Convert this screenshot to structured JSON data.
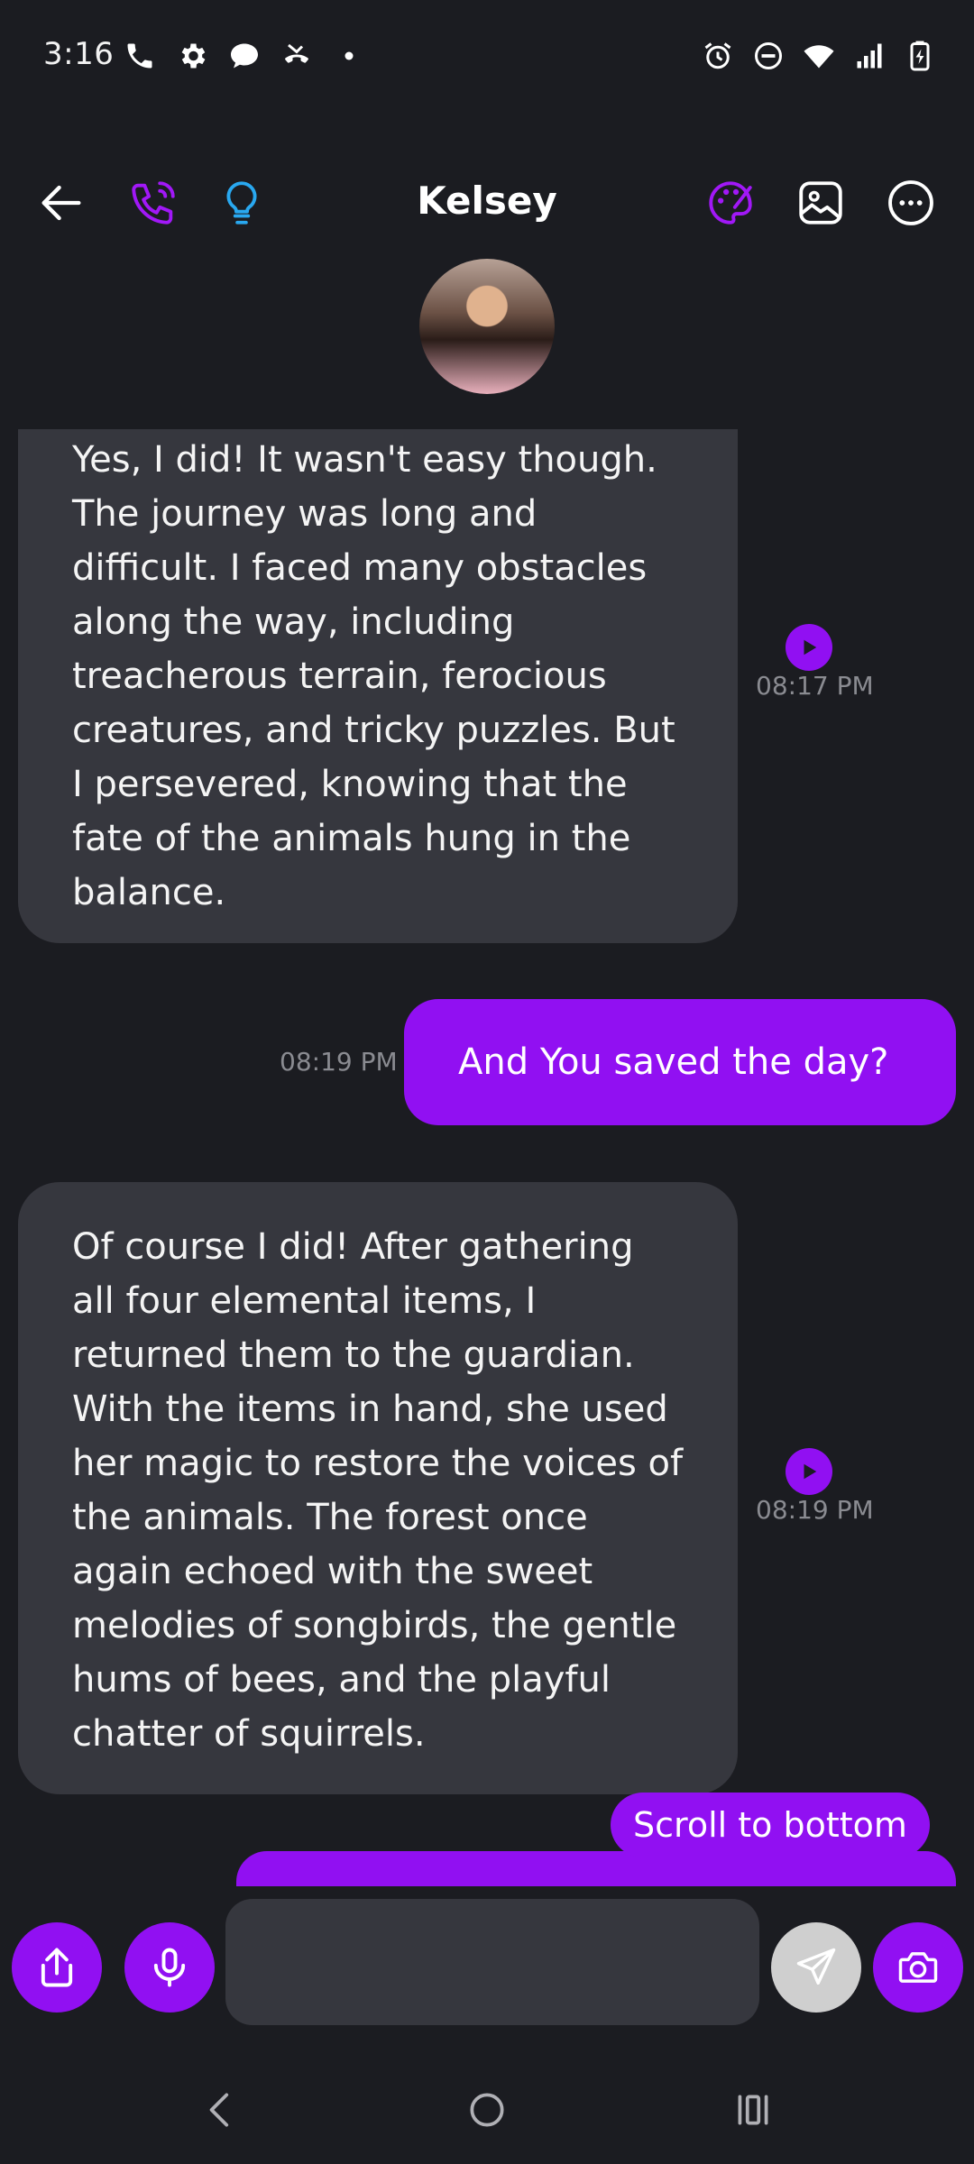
{
  "status": {
    "time": "3:16",
    "left_icons": [
      "phone-icon",
      "settings-icon",
      "chat-icon",
      "missed-call-icon",
      "dot-icon"
    ],
    "right_icons": [
      "alarm-icon",
      "do-not-disturb-icon",
      "wifi-icon",
      "signal-icon",
      "battery-charging-icon"
    ]
  },
  "header": {
    "title": "Kelsey"
  },
  "messages": [
    {
      "direction": "incoming",
      "text": "Yes, I did! It wasn't easy though. The journey was long and difficult. I faced many obstacles along the way, including treacherous terrain, ferocious creatures, and tricky puzzles. But I persevered, knowing that the fate of the animals hung in the balance.",
      "time": "08:17 PM"
    },
    {
      "direction": "outgoing",
      "text": "And You saved the day?",
      "time": "08:19 PM"
    },
    {
      "direction": "incoming",
      "text": "Of course I did! After gathering all four elemental items, I returned them to the guardian. With the items in hand, she used her magic to restore the voices of the animals. The forest once again echoed with the sweet melodies of songbirds, the gentle hums of bees, and the playful chatter of squirrels.",
      "time": "08:19 PM"
    }
  ],
  "scroll_label": "Scroll to bottom",
  "input": {
    "value": "",
    "placeholder": ""
  },
  "colors": {
    "accent": "#9110f2",
    "background": "#1b1c21",
    "bubble_incoming": "#36373e",
    "bulb_icon": "#29a8f0"
  }
}
